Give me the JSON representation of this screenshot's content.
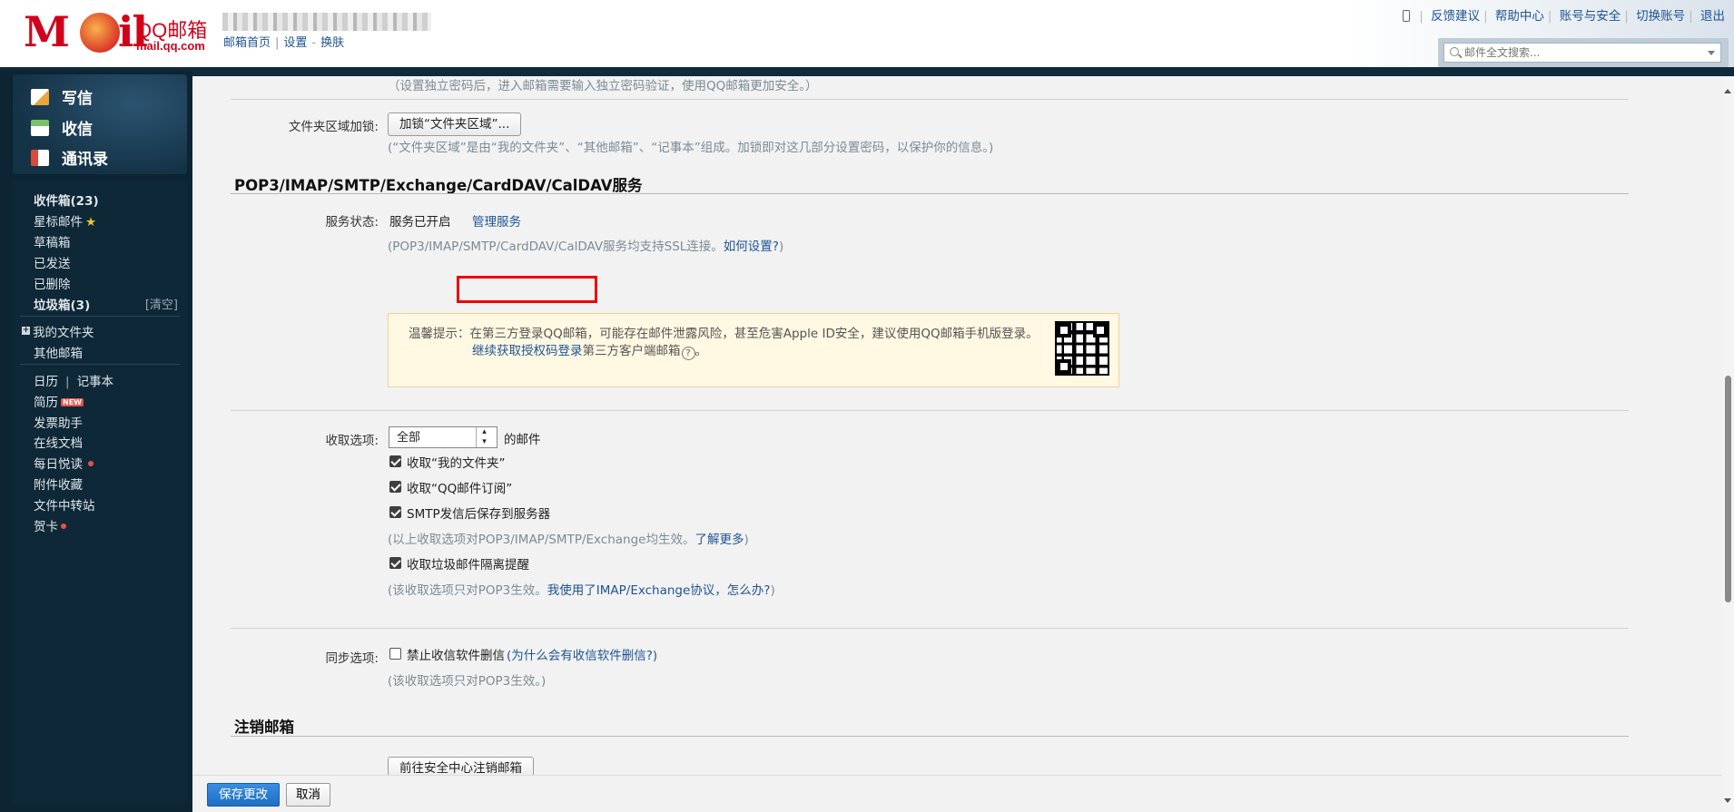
{
  "header": {
    "logo_mail": "M",
    "logo_il": "il",
    "logo_qq": "QQ邮箱",
    "logo_url": "mail.qq.com",
    "links": [
      "邮箱首页",
      "设置",
      "换肤"
    ],
    "top_right": [
      "反馈建议",
      "帮助中心",
      "账号与安全",
      "切换账号",
      "退出"
    ],
    "search_placeholder": "邮件全文搜索..."
  },
  "sidebar": {
    "compose": "写信",
    "inbox": "收信",
    "contacts": "通讯录",
    "folders": {
      "inbox": "收件箱(23)",
      "starred": "星标邮件",
      "drafts": "草稿箱",
      "sent": "已发送",
      "deleted": "已删除",
      "spam": "垃圾箱(3)",
      "clear": "[清空]",
      "my_folders": "我的文件夹",
      "other": "其他邮箱",
      "calendar": "日历",
      "notes": "记事本",
      "resume": "简历",
      "new_badge": "NEW",
      "invoice": "发票助手",
      "docs": "在线文档",
      "daily": "每日悦读",
      "attachments": "附件收藏",
      "transfer": "文件中转站",
      "cards": "贺卡"
    }
  },
  "main": {
    "top_note": "（设置独立密码后，进入邮箱需要输入独立密码验证，使用QQ邮箱更加安全。）",
    "folder_lock_label": "文件夹区域加锁:",
    "folder_lock_button": "加锁“文件夹区域”...",
    "folder_lock_note": "(“文件夹区域”是由“我的文件夹”、“其他邮箱”、“记事本”组成。加锁即对这几部分设置密码，以保护你的信息。)",
    "pop_title": "POP3/IMAP/SMTP/Exchange/CardDAV/CalDAV服务",
    "service_status_label": "服务状态:",
    "service_status_value": "服务已开启",
    "manage_service": "管理服务",
    "ssl_note": "(POP3/IMAP/SMTP/CardDAV/CalDAV服务均支持SSL连接。",
    "how_setup": "如何设置?",
    "ssl_note_end": ")",
    "warn_line1": "温馨提示：在第三方登录QQ邮箱，可能存在邮件泄露风险，甚至危害Apple ID安全，建议使用QQ邮箱手机版登录。",
    "warn_link": "继续获取授权码登录",
    "warn_line2_rest": "第三方客户端邮箱",
    "warn_line2_end": "。",
    "help_icon": "?",
    "receive_label": "收取选项:",
    "receive_select": "全部",
    "receive_suffix": "的邮件",
    "chk_my_folders": "收取“我的文件夹”",
    "chk_qq_sub": "收取“QQ邮件订阅”",
    "chk_smtp_save": "SMTP发信后保存到服务器",
    "chk_note": "(以上收取选项对POP3/IMAP/SMTP/Exchange均生效。",
    "learn_more": "了解更多",
    "chk_note_end": ")",
    "chk_spam": "收取垃圾邮件隔离提醒",
    "spam_note": "(该收取选项只对POP3生效。",
    "spam_note_link": "我使用了IMAP/Exchange协议，怎么办?",
    "spam_note_end": ")",
    "sync_label": "同步选项:",
    "sync_chk": "禁止收信软件删信",
    "sync_link": "(为什么会有收信软件删信?)",
    "sync_note": "(该收取选项只对POP3生效。)",
    "cancel_title": "注销邮箱",
    "cancel_button": "前往安全中心注销邮箱",
    "save_button": "保存更改",
    "cancel_btn": "取消"
  }
}
